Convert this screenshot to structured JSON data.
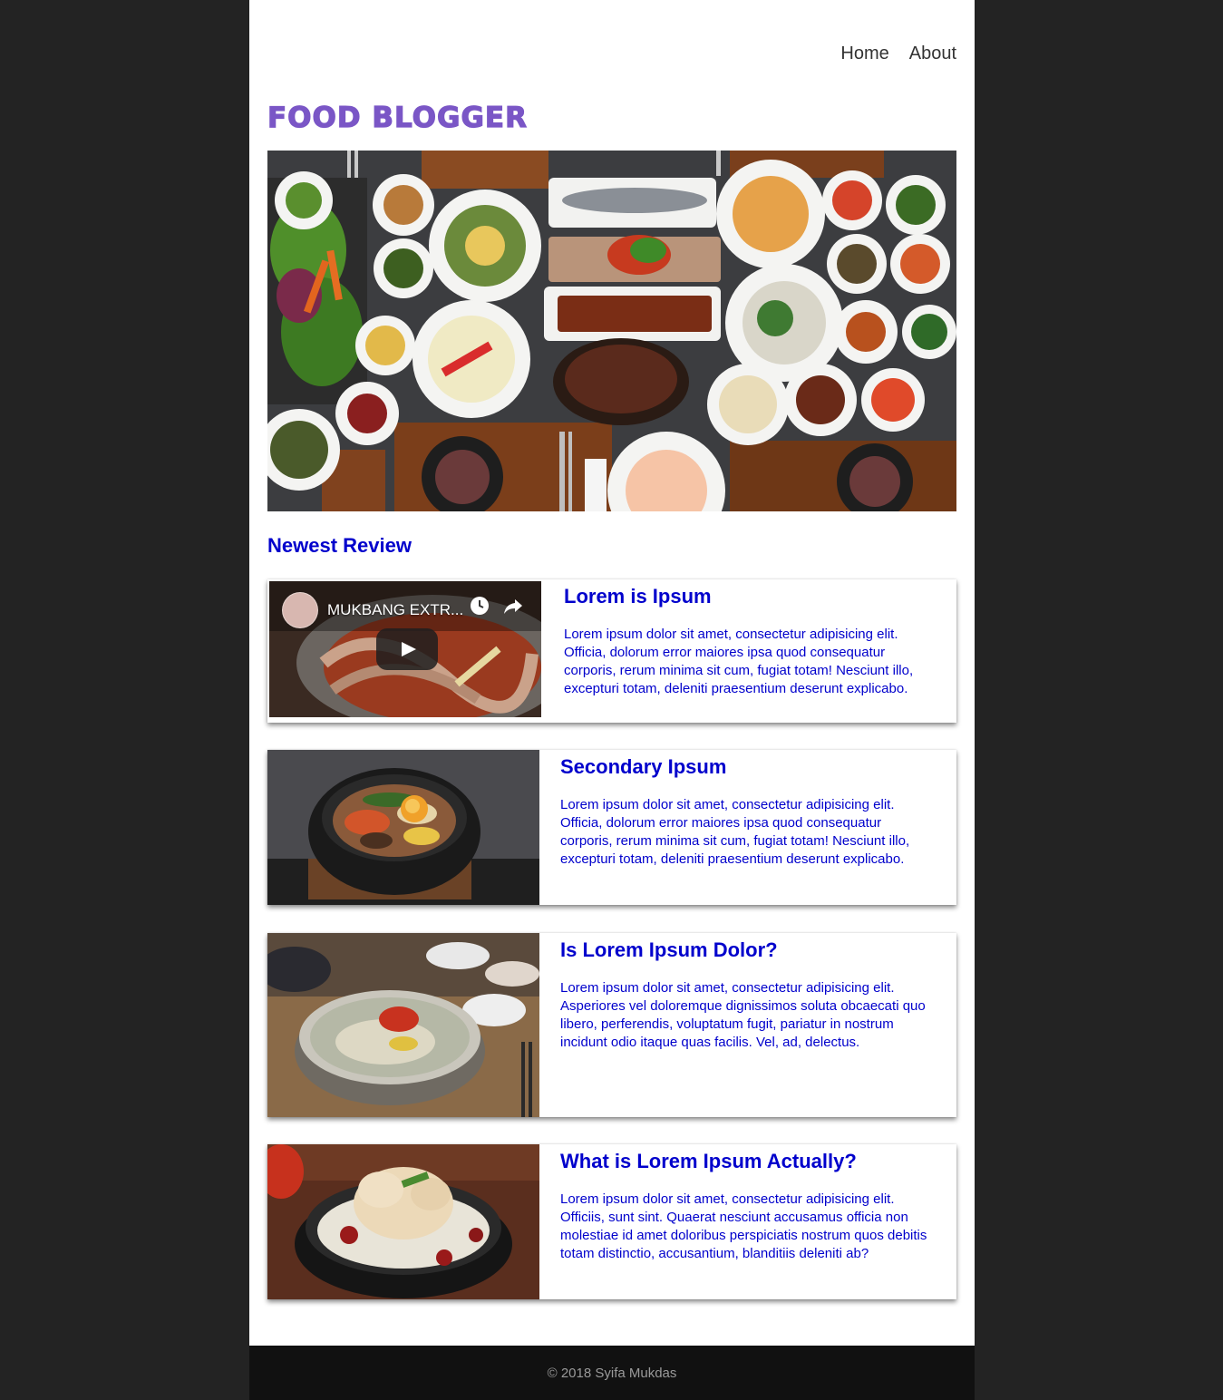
{
  "nav": {
    "home_label": "Home",
    "about_label": "About"
  },
  "brand": {
    "logo_text": "Food Blogger",
    "accent_color": "#7a56c6",
    "link_color": "#0000cc"
  },
  "main": {
    "section_title": "Newest Review",
    "reviews": [
      {
        "title": "Lorem is Ipsum",
        "body": "Lorem ipsum dolor sit amet, consectetur adipisicing elit. Officia, dolorum error maiores ipsa quod consequatur corporis, rerum minima sit cum, fugiat totam! Nesciunt illo, excepturi totam, deleniti praesentium deserunt explicabo.",
        "media": {
          "video_title": "MUKBANG EXTR...",
          "icons": [
            "clock-icon",
            "share-icon",
            "play-icon"
          ]
        }
      },
      {
        "title": "Secondary Ipsum",
        "body": "Lorem ipsum dolor sit amet, consectetur adipisicing elit. Officia, dolorum error maiores ipsa quod consequatur corporis, rerum minima sit cum, fugiat totam! Nesciunt illo, excepturi totam, deleniti praesentium deserunt explicabo."
      },
      {
        "title": "Is Lorem Ipsum Dolor?",
        "body": "Lorem ipsum dolor sit amet, consectetur adipisicing elit. Asperiores vel doloremque dignissimos soluta obcaecati quo libero, perferendis, voluptatum fugit, pariatur in nostrum incidunt odio itaque quas facilis. Vel, ad, delectus."
      },
      {
        "title": "What is Lorem Ipsum Actually?",
        "body": "Lorem ipsum dolor sit amet, consectetur adipisicing elit. Officiis, sunt sint. Quaerat nesciunt accusamus officia non molestiae id amet doloribus perspiciatis nostrum quos debitis totam distinctio, accusantium, blanditiis deleniti ab?"
      }
    ]
  },
  "footer": {
    "copyright": "© 2018 Syifa Mukdas"
  }
}
